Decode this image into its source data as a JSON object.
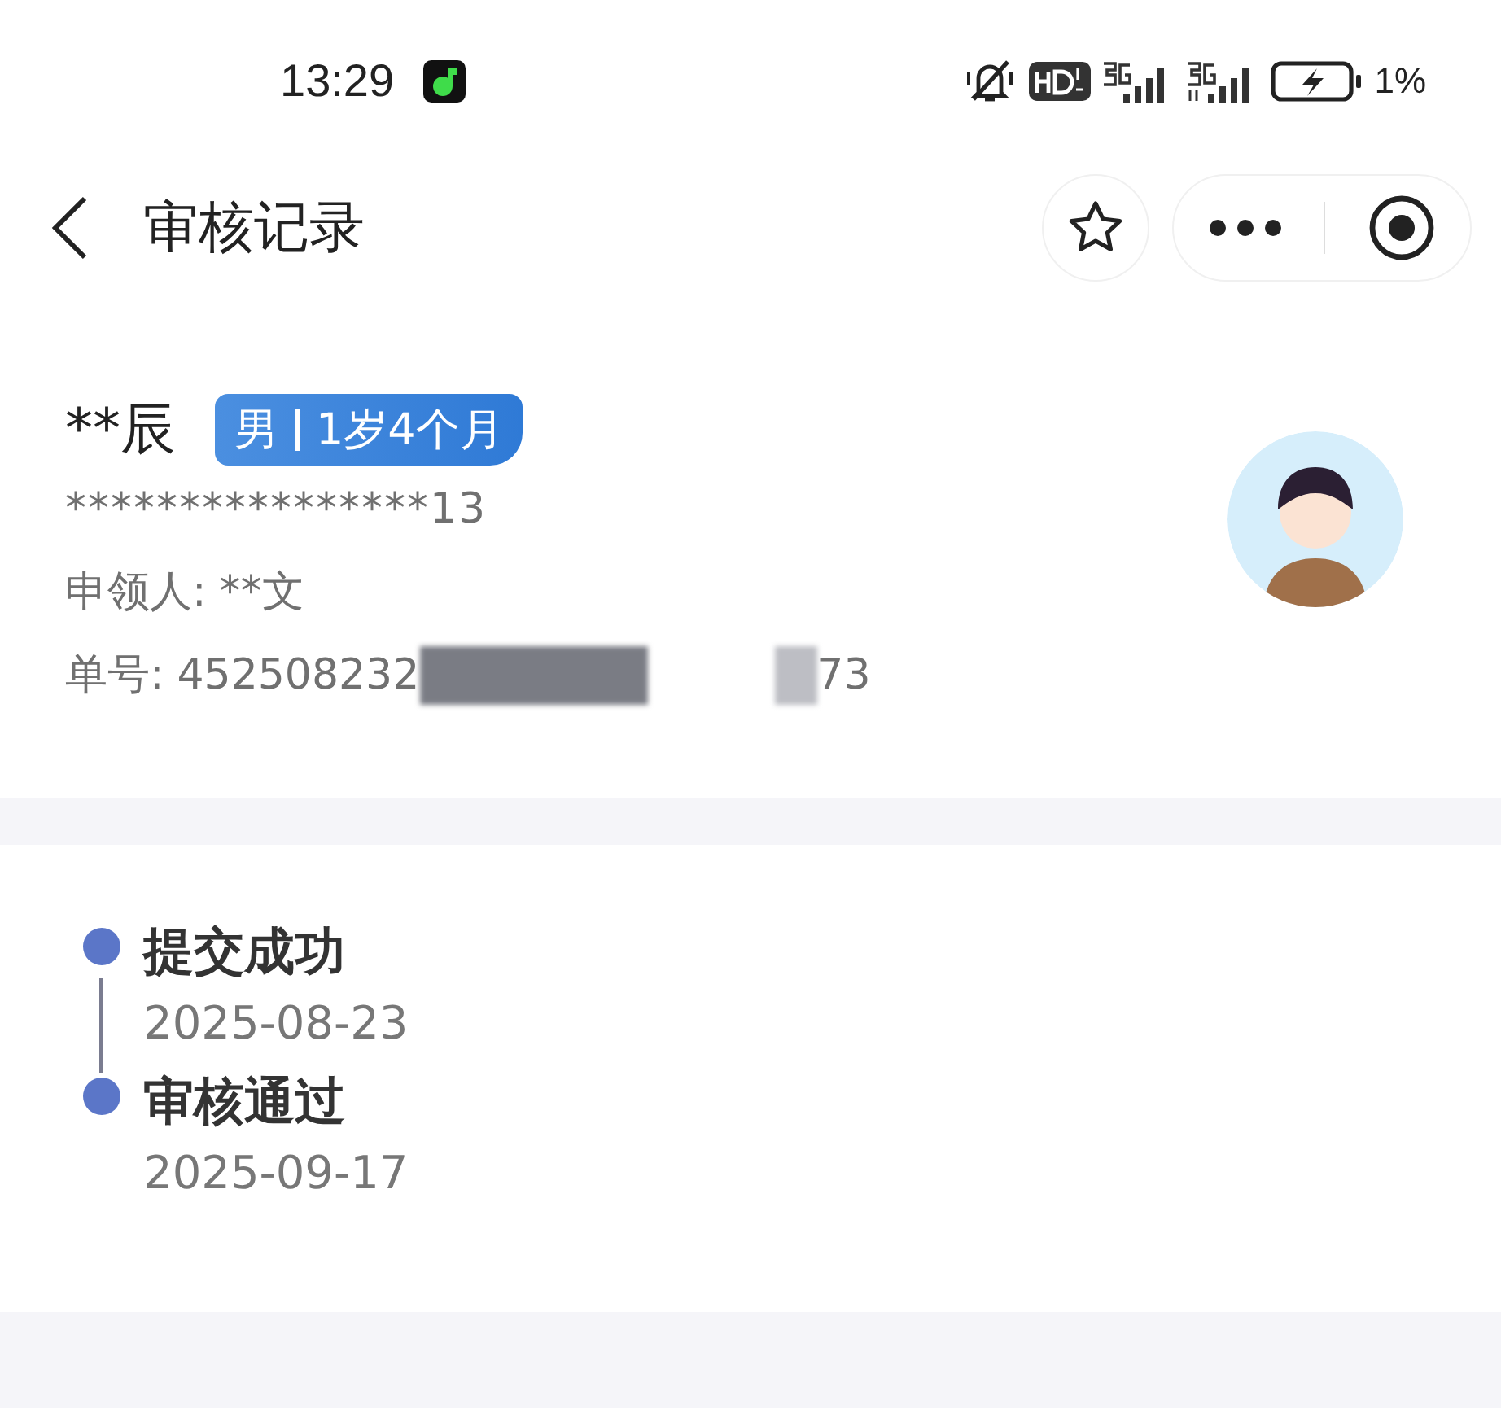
{
  "status_bar": {
    "time": "13:29",
    "battery": "1%"
  },
  "nav": {
    "title": "审核记录"
  },
  "profile": {
    "name": "**辰",
    "gender": "男",
    "age": "1岁4个月",
    "phone": "****************13",
    "applicant_label": "申领人:",
    "applicant": "**文",
    "order_label": "单号:",
    "order_start": "452508232",
    "order_end": "73"
  },
  "timeline": [
    {
      "title": "提交成功",
      "date": "2025-08-23",
      "color": "#5b76c8"
    },
    {
      "title": "审核通过",
      "date": "2025-09-17",
      "color": "#5b76c8"
    }
  ]
}
